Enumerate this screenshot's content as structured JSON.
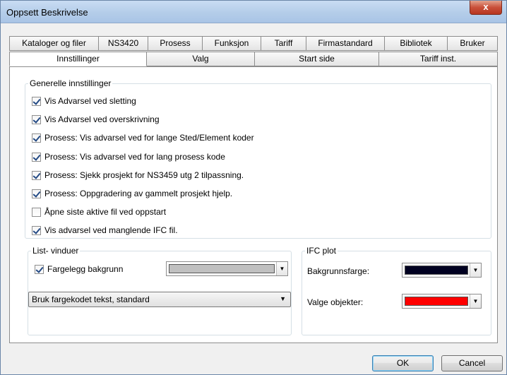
{
  "window": {
    "title": "Oppsett Beskrivelse",
    "close_glyph": "x"
  },
  "tabs_back": [
    "Kataloger og filer",
    "NS3420",
    "Prosess",
    "Funksjon",
    "Tariff",
    "Firmastandard",
    "Bibliotek",
    "Bruker"
  ],
  "tabs_front": [
    "Innstillinger",
    "Valg",
    "Start side",
    "Tariff inst."
  ],
  "general": {
    "legend": "Generelle innstillinger",
    "options": [
      {
        "label": "Vis Advarsel ved sletting",
        "checked": true
      },
      {
        "label": "Vis Advarsel ved overskrivning",
        "checked": true
      },
      {
        "label": "Prosess: Vis advarsel ved for lange Sted/Element koder",
        "checked": true
      },
      {
        "label": "Prosess: Vis advarsel ved for lang prosess kode",
        "checked": true
      },
      {
        "label": "Prosess: Sjekk prosjekt for NS3459 utg 2 tilpassning.",
        "checked": true
      },
      {
        "label": "Prosess: Oppgradering av gammelt prosjekt hjelp.",
        "checked": true
      },
      {
        "label": "Åpne siste aktive fil ved oppstart",
        "checked": false
      },
      {
        "label": "Vis advarsel ved manglende IFC fil.",
        "checked": true
      }
    ]
  },
  "list_windows": {
    "legend": "List- vinduer",
    "color_bg_label": "Fargelegg bakgrunn",
    "color_bg_checked": true,
    "color_bg_value": "#c0c0c0",
    "text_style_value": "Bruk fargekodet tekst, standard"
  },
  "ifc_plot": {
    "legend": "IFC plot",
    "background_label": "Bakgrunnsfarge:",
    "background_color": "#000020",
    "selected_label": "Valge objekter:",
    "selected_color": "#ff0000"
  },
  "buttons": {
    "ok": "OK",
    "cancel": "Cancel"
  }
}
